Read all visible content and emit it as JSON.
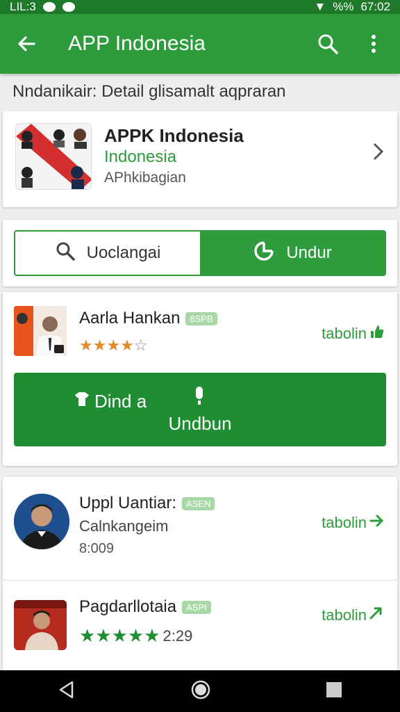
{
  "status_bar": {
    "left_text": "LIL:3",
    "right_text": "%%",
    "time": "67:02"
  },
  "app_bar": {
    "title": "APP Indonesia",
    "back_icon": "arrow-left-icon",
    "search_icon": "search-icon",
    "menu_icon": "more-vert-icon"
  },
  "subheader": "Nndanikair: Detail glisamalt aqpraran",
  "app_card": {
    "name": "APPK Indonesia",
    "country": "Indonesia",
    "category": "APhkibagian"
  },
  "toggle": {
    "left_label": "Uoclangai",
    "right_label": "Undur"
  },
  "featured": {
    "name": "Aarla Hankan",
    "badge": "8SPB",
    "rating": 3.5,
    "rating_max": 5,
    "side_action": "tabolin",
    "button_line1": "Dind a",
    "button_line2": "Undbun"
  },
  "list": [
    {
      "name": "Uppl Uantiar:",
      "badge": "ASEN",
      "subtitle": "Calnkangeim",
      "meta": "8:009",
      "side_action": "tabolin"
    },
    {
      "name": "Pagdarllotaia",
      "badge": "ASPI",
      "rating": 5,
      "rating_text": "2:29",
      "side_action": "tabolin"
    }
  ],
  "colors": {
    "primary": "#2e9b3c",
    "primary_dark": "#1e7a2a",
    "button": "#1f8e33",
    "accent_star": "#e08a2c"
  }
}
